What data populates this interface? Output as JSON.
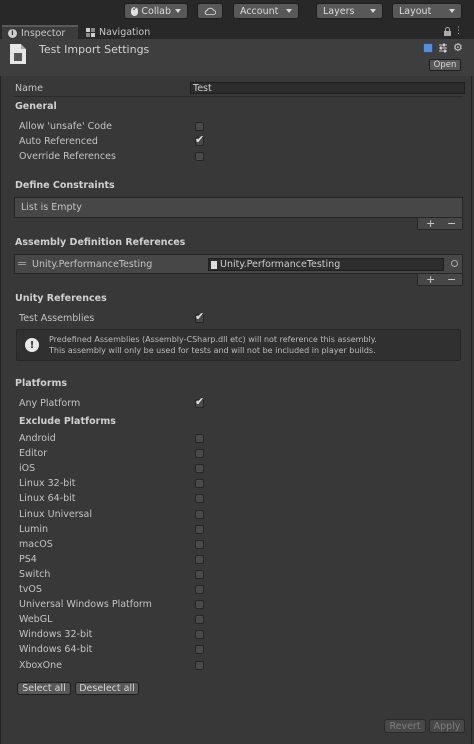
{
  "toolbar": {
    "collab": "Collab",
    "account": "Account",
    "layers": "Layers",
    "layout": "Layout"
  },
  "tabs": [
    {
      "label": "Inspector"
    },
    {
      "label": "Navigation"
    }
  ],
  "header": {
    "title": "Test Import Settings",
    "open_label": "Open"
  },
  "name_field": {
    "label": "Name",
    "value": "Test"
  },
  "general": {
    "heading": "General",
    "allow_unsafe": {
      "label": "Allow 'unsafe' Code",
      "checked": false
    },
    "auto_referenced": {
      "label": "Auto Referenced",
      "checked": true
    },
    "override_references": {
      "label": "Override References",
      "checked": false
    }
  },
  "define_constraints": {
    "heading": "Define Constraints",
    "empty_text": "List is Empty",
    "add": "+",
    "remove": "−"
  },
  "assembly_refs": {
    "heading": "Assembly Definition References",
    "item_name": "Unity.PerformanceTesting",
    "item_value": "Unity.PerformanceTesting",
    "add": "+",
    "remove": "−"
  },
  "unity_refs": {
    "heading": "Unity References",
    "test_assemblies": {
      "label": "Test Assemblies",
      "checked": true
    },
    "help_line1": "Predefined Assemblies (Assembly-CSharp.dll etc) will not reference this assembly.",
    "help_line2": "This assembly will only be used for tests and will not be included in player builds."
  },
  "platforms": {
    "heading": "Platforms",
    "any_platform": {
      "label": "Any Platform",
      "checked": true
    },
    "exclude_heading": "Exclude Platforms",
    "items": [
      {
        "label": "Android",
        "checked": false
      },
      {
        "label": "Editor",
        "checked": false
      },
      {
        "label": "iOS",
        "checked": false
      },
      {
        "label": "Linux 32-bit",
        "checked": false
      },
      {
        "label": "Linux 64-bit",
        "checked": false
      },
      {
        "label": "Linux Universal",
        "checked": false
      },
      {
        "label": "Lumin",
        "checked": false
      },
      {
        "label": "macOS",
        "checked": false
      },
      {
        "label": "PS4",
        "checked": false
      },
      {
        "label": "Switch",
        "checked": false
      },
      {
        "label": "tvOS",
        "checked": false
      },
      {
        "label": "Universal Windows Platform",
        "checked": false
      },
      {
        "label": "WebGL",
        "checked": false
      },
      {
        "label": "Windows 32-bit",
        "checked": false
      },
      {
        "label": "Windows 64-bit",
        "checked": false
      },
      {
        "label": "XboxOne",
        "checked": false
      }
    ],
    "select_all": "Select all",
    "deselect_all": "Deselect all"
  },
  "footer": {
    "revert": "Revert",
    "apply": "Apply"
  },
  "colors": {
    "background": "#383838",
    "toolbar": "#282828",
    "button": "#585858"
  }
}
